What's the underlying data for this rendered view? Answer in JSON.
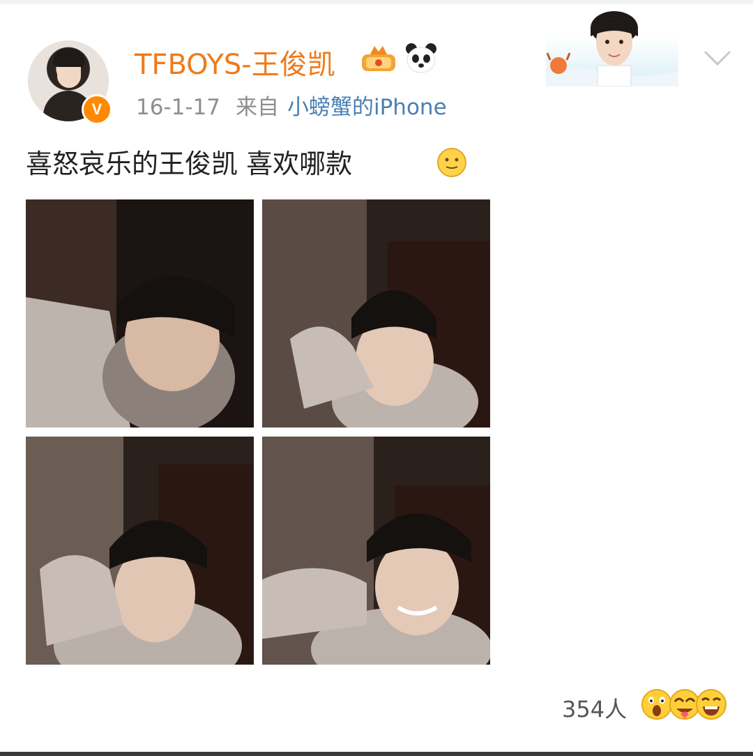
{
  "post": {
    "username": "TFBOYS-王俊凯",
    "meta": {
      "date": "16-1-17",
      "from_label": "来自",
      "source": "小螃蟹的iPhone"
    },
    "text": "喜怒哀乐的王俊凯 喜欢哪款",
    "photos": [
      {
        "id": 1
      },
      {
        "id": 2
      },
      {
        "id": 3
      },
      {
        "id": 4
      }
    ],
    "reactions": {
      "count": "354人",
      "icons": [
        "wow-emoji-icon",
        "love-emoji-icon",
        "laugh-emoji-icon"
      ]
    }
  },
  "icons": {
    "verified": "V",
    "verified_color": "#ff8a00",
    "username_color": "#f07a1a",
    "link_color": "#4b7fb3",
    "crown": "crown-icon",
    "panda": "panda-icon",
    "more": "chevron-down-icon",
    "emoji": "smile-emoji-icon"
  }
}
